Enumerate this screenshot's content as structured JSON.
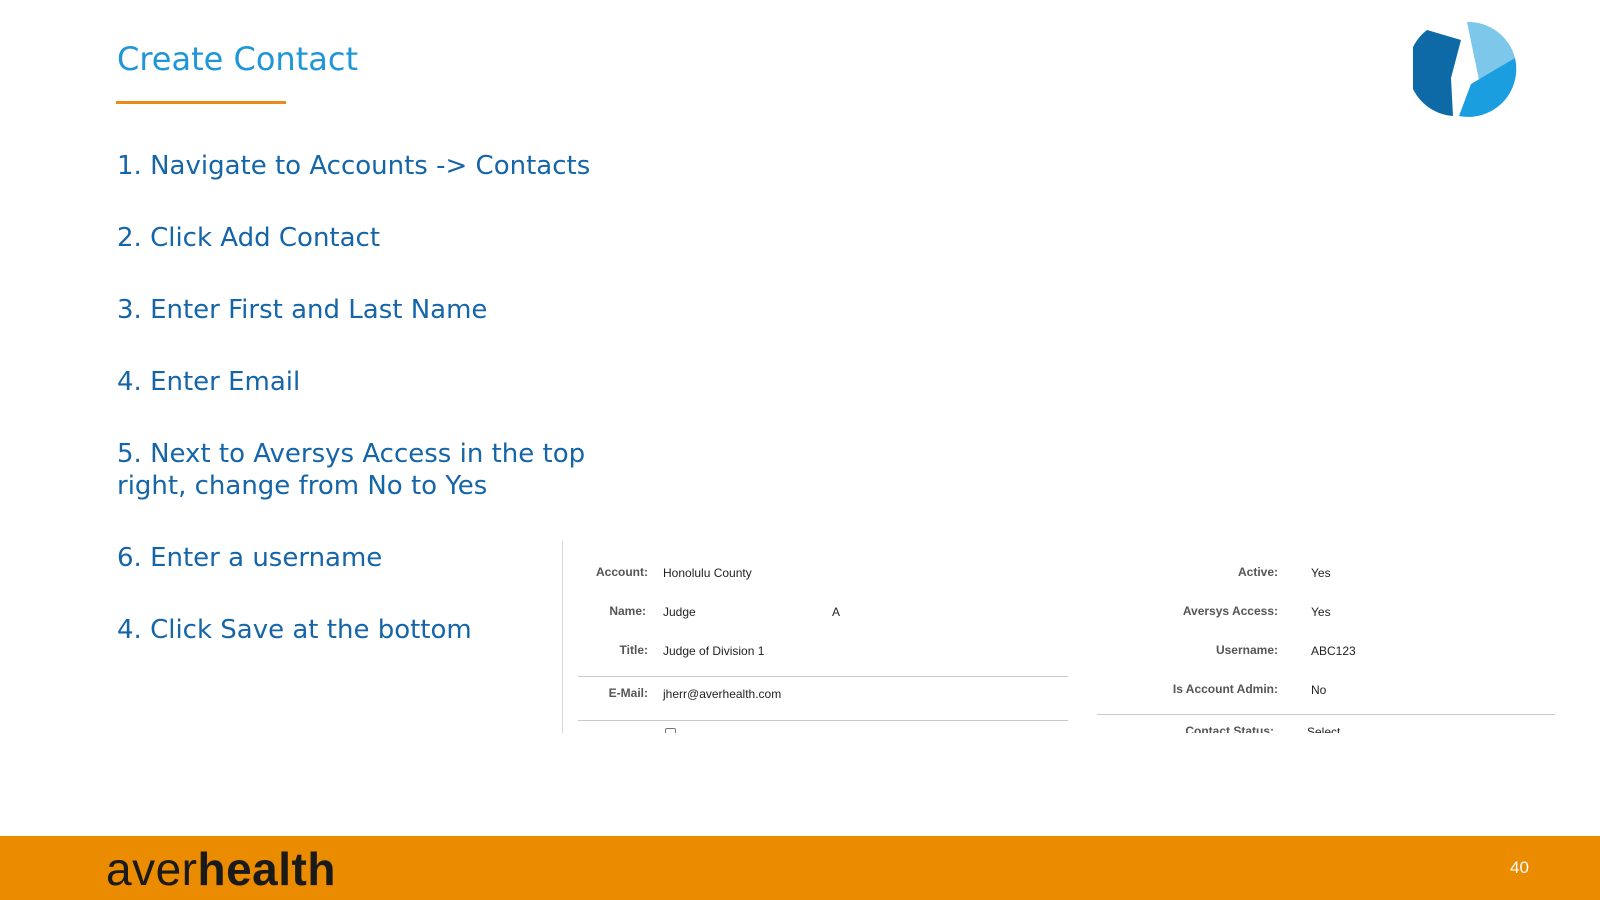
{
  "slide": {
    "title": "Create Contact",
    "page_number": "40",
    "brand_prefix": "aver",
    "brand_suffix": "health",
    "logo_icon": "averhealth-swirl-logo",
    "colors": {
      "accent_blue": "#1e96d8",
      "step_blue": "#1565a8",
      "orange": "#ea8b00"
    }
  },
  "steps": [
    "1. Navigate to Accounts -> Contacts",
    "2. Click Add Contact",
    "3. Enter First and Last Name",
    "4. Enter Email",
    "5. Next to Aversys Access in the top\nright, change from No to Yes",
    "6. Enter a username",
    "4. Click Save at the bottom"
  ],
  "form": {
    "left": {
      "account_label": "Account:",
      "account_value": "Honolulu County",
      "name_label": "Name:",
      "name_first": "Judge",
      "name_last": "A",
      "title_label": "Title:",
      "title_value": "Judge of Division 1",
      "email_label": "E-Mail:",
      "email_value": "jherr@averhealth.com"
    },
    "right": {
      "active_label": "Active:",
      "active_value": "Yes",
      "aversys_label": "Aversys Access:",
      "aversys_value": "Yes",
      "username_label": "Username:",
      "username_value": "ABC123",
      "admin_label": "Is Account Admin:",
      "admin_value": "No",
      "status_label": "Contact Status:",
      "status_value": "Select"
    }
  }
}
